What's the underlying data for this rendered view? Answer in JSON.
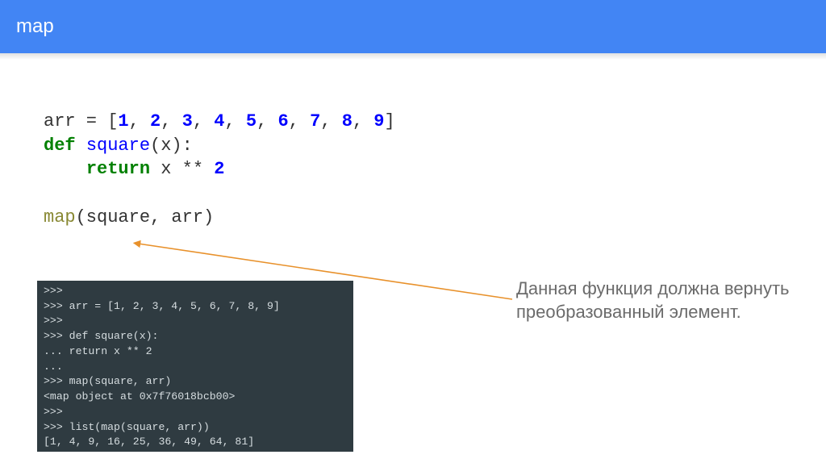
{
  "header": {
    "title": "map"
  },
  "code": {
    "line1_prefix": "arr = [",
    "n1": "1",
    "n2": "2",
    "n3": "3",
    "n4": "4",
    "n5": "5",
    "n6": "6",
    "n7": "7",
    "n8": "8",
    "n9": "9",
    "line1_suffix": "]",
    "def_kw": "def",
    "fn_name": "square",
    "fn_args": "(x):",
    "return_kw": "return",
    "return_expr_a": " x ** ",
    "return_num": "2",
    "map_call_fn": "map",
    "map_call_args": "(square, arr)"
  },
  "terminal": {
    "l1": ">>>",
    "l2": ">>> arr = [1, 2, 3, 4, 5, 6, 7, 8, 9]",
    "l3": ">>>",
    "l4": ">>> def square(x):",
    "l5": "...     return x ** 2",
    "l6": "...",
    "l7": ">>> map(square, arr)",
    "l8": "<map object at 0x7f76018bcb00>",
    "l9": ">>>",
    "l10": ">>> list(map(square, arr))",
    "l11": "[1, 4, 9, 16, 25, 36, 49, 64, 81]"
  },
  "annotation": {
    "text": "Данная функция должна вернуть преобразованный элемент."
  },
  "colors": {
    "header_bg": "#4285f4",
    "terminal_bg": "#2f3b41",
    "arrow": "#e8912b"
  }
}
